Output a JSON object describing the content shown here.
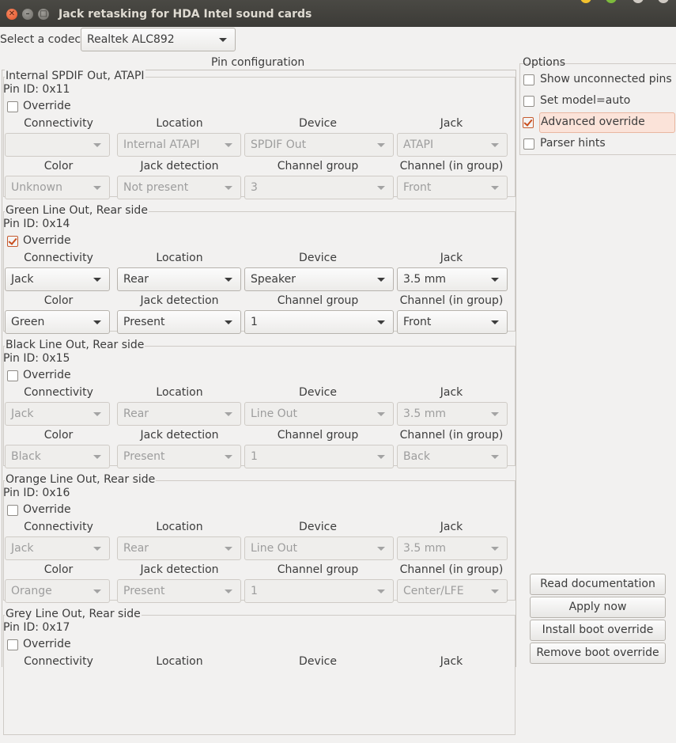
{
  "window": {
    "title": "Jack retasking for HDA Intel sound cards"
  },
  "codec": {
    "label": "Select a codec:",
    "value": "Realtek ALC892"
  },
  "pin_config": {
    "title": "Pin configuration",
    "headers": [
      "Connectivity",
      "Location",
      "Device",
      "Jack",
      "Color",
      "Jack detection",
      "Channel group",
      "Channel (in group)"
    ],
    "override_label": "Override",
    "sections": [
      {
        "title": "Internal SPDIF Out, ATAPI",
        "pin_id": "Pin ID: 0x11",
        "override": false,
        "connectivity": "",
        "location": "Internal ATAPI",
        "device": "SPDIF Out",
        "jack": "ATAPI",
        "color": "Unknown",
        "jack_detection": "Not present",
        "channel_group": "3",
        "channel": "Front"
      },
      {
        "title": "Green Line Out, Rear side",
        "pin_id": "Pin ID: 0x14",
        "override": true,
        "connectivity": "Jack",
        "location": "Rear",
        "device": "Speaker",
        "jack": "3.5 mm",
        "color": "Green",
        "jack_detection": "Present",
        "channel_group": "1",
        "channel": "Front"
      },
      {
        "title": "Black Line Out, Rear side",
        "pin_id": "Pin ID: 0x15",
        "override": false,
        "connectivity": "Jack",
        "location": "Rear",
        "device": "Line Out",
        "jack": "3.5 mm",
        "color": "Black",
        "jack_detection": "Present",
        "channel_group": "1",
        "channel": "Back"
      },
      {
        "title": "Orange Line Out, Rear side",
        "pin_id": "Pin ID: 0x16",
        "override": false,
        "connectivity": "Jack",
        "location": "Rear",
        "device": "Line Out",
        "jack": "3.5 mm",
        "color": "Orange",
        "jack_detection": "Present",
        "channel_group": "1",
        "channel": "Center/LFE"
      },
      {
        "title": "Grey Line Out, Rear side",
        "pin_id": "Pin ID: 0x17",
        "override": false,
        "connectivity": "",
        "location": "",
        "device": "",
        "jack": "",
        "color": "",
        "jack_detection": "",
        "channel_group": "",
        "channel": ""
      }
    ]
  },
  "options": {
    "title": "Options",
    "items": [
      {
        "label": "Show unconnected pins",
        "checked": false
      },
      {
        "label": "Set model=auto",
        "checked": false
      },
      {
        "label": "Advanced override",
        "checked": true
      },
      {
        "label": "Parser hints",
        "checked": false
      }
    ]
  },
  "actions": {
    "read_documentation": "Read documentation",
    "apply_now": "Apply now",
    "install_boot_override": "Install boot override",
    "remove_boot_override": "Remove boot override"
  },
  "colors": {
    "accent": "#e2542a",
    "titlebar": "#3c3b37",
    "window_bg": "#f2f1f0",
    "highlight": "#fbe3d9"
  }
}
